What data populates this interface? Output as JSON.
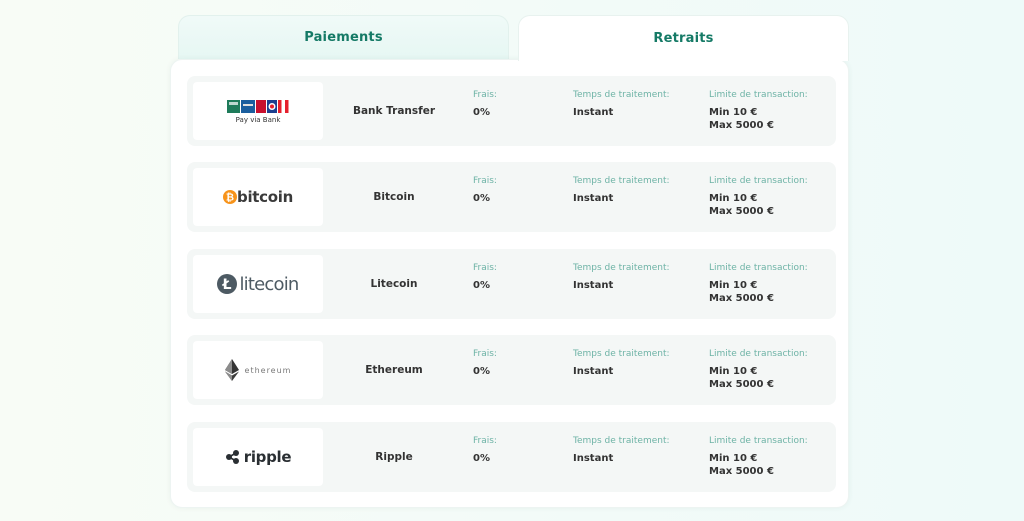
{
  "tabs": {
    "payments_label": "Paiements",
    "withdrawals_label": "Retraits"
  },
  "columns": {
    "fees_label": "Frais:",
    "processing_label": "Temps de traitement:",
    "limit_label": "Limite de transaction:"
  },
  "methods": [
    {
      "name": "Bank Transfer",
      "logo_icon": "pay-via-bank-logo",
      "logo_text": "Pay via Bank",
      "fees": "0%",
      "processing": "Instant",
      "limit_min": "Min 10 €",
      "limit_max": "Max 5000 €"
    },
    {
      "name": "Bitcoin",
      "logo_icon": "bitcoin-logo",
      "logo_text": "bitcoin",
      "fees": "0%",
      "processing": "Instant",
      "limit_min": "Min 10 €",
      "limit_max": "Max 5000 €"
    },
    {
      "name": "Litecoin",
      "logo_icon": "litecoin-logo",
      "logo_text": "litecoin",
      "fees": "0%",
      "processing": "Instant",
      "limit_min": "Min 10 €",
      "limit_max": "Max 5000 €"
    },
    {
      "name": "Ethereum",
      "logo_icon": "ethereum-logo",
      "logo_text": "ethereum",
      "fees": "0%",
      "processing": "Instant",
      "limit_min": "Min 10 €",
      "limit_max": "Max 5000 €"
    },
    {
      "name": "Ripple",
      "logo_icon": "ripple-logo",
      "logo_text": "ripple",
      "fees": "0%",
      "processing": "Instant",
      "limit_min": "Min 10 €",
      "limit_max": "Max 5000 €"
    }
  ],
  "colors": {
    "accent": "#157a66",
    "label": "#6eb3a6",
    "row_bg": "#f4f7f6",
    "bitcoin": "#f7931a",
    "litecoin": "#4d5a63"
  }
}
